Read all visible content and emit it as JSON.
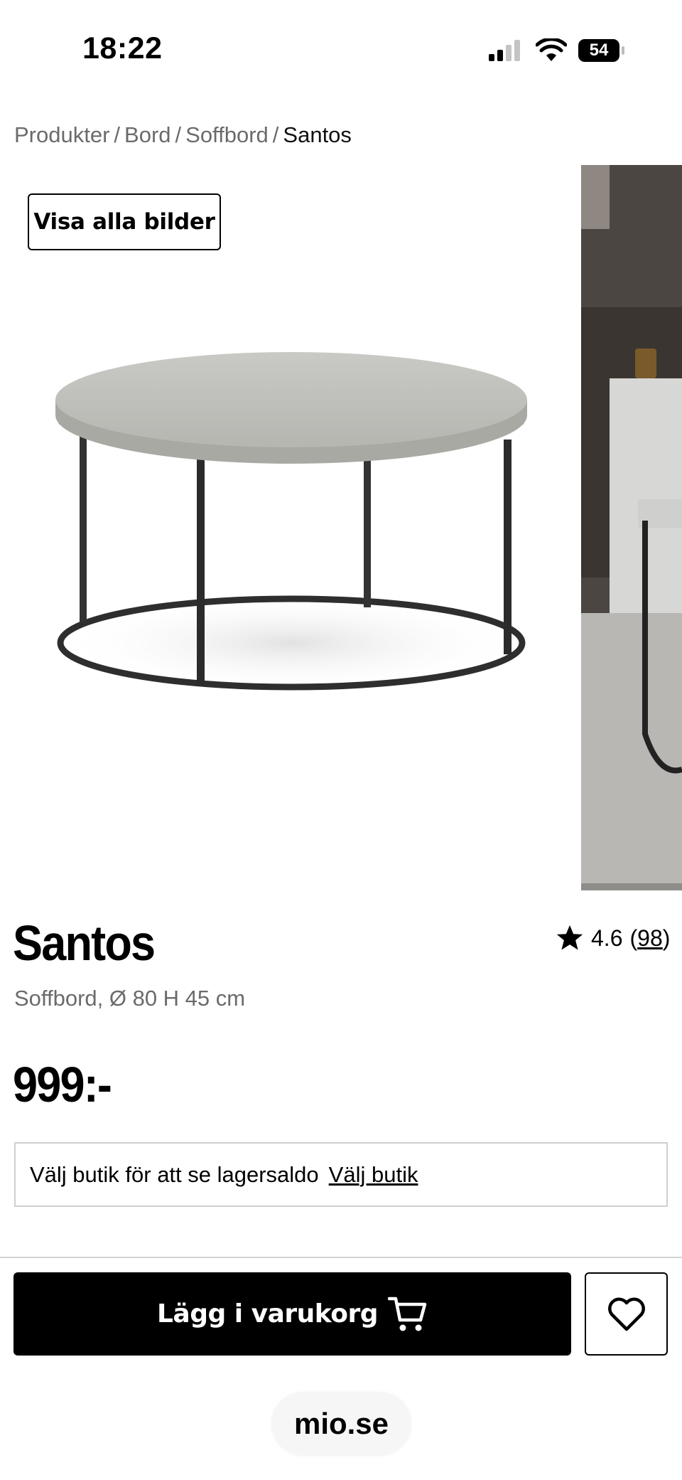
{
  "status_bar": {
    "time": "18:22",
    "battery": "54"
  },
  "breadcrumb": {
    "items": [
      "Produkter",
      "Bord",
      "Soffbord"
    ],
    "separator": "/",
    "current": "Santos"
  },
  "gallery": {
    "view_all_label": "Visa alla bilder"
  },
  "product": {
    "name": "Santos",
    "rating": "4.6",
    "review_count": "98",
    "description": "Soffbord, Ø 80 H 45 cm",
    "price": "999:-"
  },
  "stock": {
    "text": "Välj butik för att se lagersaldo",
    "link_label": "Välj butik"
  },
  "actions": {
    "add_to_cart_label": "Lägg i varukorg"
  },
  "browser": {
    "url": "mio.se"
  },
  "colors": {
    "primary": "#000000",
    "muted_text": "#6b6b6b",
    "border": "#cfcfcf"
  },
  "icons": [
    "signal-icon",
    "wifi-icon",
    "battery-icon",
    "star-icon",
    "cart-icon",
    "heart-icon"
  ]
}
